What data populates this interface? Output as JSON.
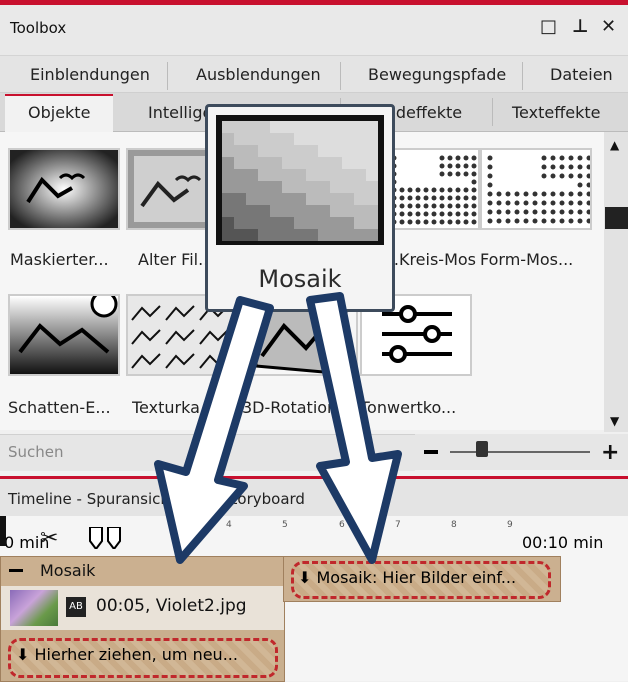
{
  "window": {
    "title": "Toolbox",
    "controls": [
      "□",
      "⊥",
      "✕"
    ]
  },
  "tabs_row1": [
    "Einblendungen",
    "Ausblendungen",
    "Bewegungspfade",
    "Dateien"
  ],
  "tabs_row2": [
    "Objekte",
    "Intelligente Vorlagen",
    "Bildeffekte",
    "Texteffekte"
  ],
  "active_tab": "Objekte",
  "items": [
    {
      "label": "Maskierter...",
      "icon": "mask-landscape-icon"
    },
    {
      "label": "Alter Fil...",
      "icon": "old-film-icon"
    },
    {
      "label": "Mosaik",
      "icon": "mosaic-icon"
    },
    {
      "label": "Kreis-Mos...",
      "icon": "circle-mosaic-icon"
    },
    {
      "label": "Form-Mos...",
      "icon": "shape-mosaic-icon"
    },
    {
      "label": "Schatten-E...",
      "icon": "shadow-landscape-icon"
    },
    {
      "label": "Texturka...",
      "icon": "texture-tiles-icon"
    },
    {
      "label": "3D-Rotation",
      "icon": "3d-rotation-icon"
    },
    {
      "label": "Tonwertko...",
      "icon": "tone-sliders-icon"
    }
  ],
  "tooltip": {
    "label": "Mosaik"
  },
  "search": {
    "placeholder": "Suchen"
  },
  "timeline": {
    "tabs": [
      "Timeline - Spuransicht",
      "Storyboard"
    ],
    "ruler": {
      "start_label": "0 min",
      "end_label": "00:10 min",
      "ticks": [
        "4",
        "5",
        "6",
        "7",
        "8",
        "9"
      ]
    },
    "object_name": "Mosaik",
    "clip_label": "00:05, Violet2.jpg",
    "drop_placeholder": "Hierher ziehen, um neu...",
    "mosaic_placeholder": "Mosaik: Hier Bilder einf..."
  },
  "colors": {
    "accent": "#c8102e",
    "popup_border": "#3d4b5c",
    "track": "#cbb090"
  }
}
